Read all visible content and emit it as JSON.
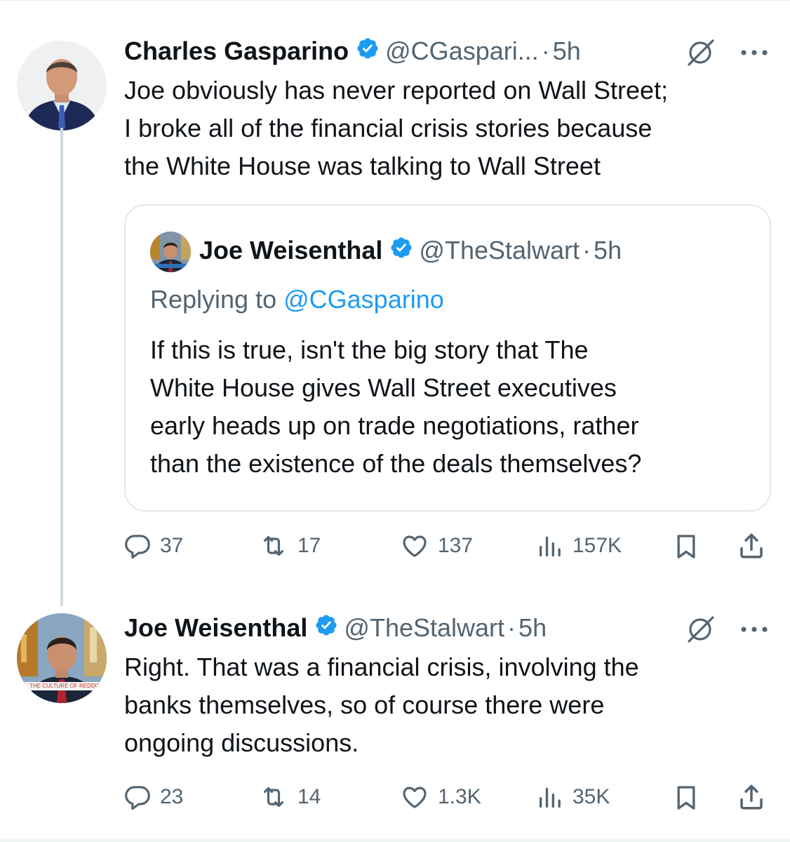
{
  "tweet1": {
    "name": "Charles Gasparino",
    "handle": "@CGaspari...",
    "separator": "·",
    "time": "5h",
    "text": [
      "Joe obviously has never reported on Wall Street;",
      "I broke all of the financial crisis stories because",
      "the White House was talking to Wall Street"
    ],
    "quote": {
      "name": "Joe Weisenthal",
      "handle": "@TheStalwart",
      "separator": "·",
      "time": "5h",
      "replying_prefix": "Replying to",
      "replying_handle": "@CGasparino",
      "text": [
        "If this is true, isn't the big story that The",
        "White House gives Wall Street executives",
        "early heads up on trade negotiations, rather",
        "than the existence of the deals themselves?"
      ]
    },
    "replies": "37",
    "reposts": "17",
    "likes": "137",
    "views": "157K"
  },
  "tweet2": {
    "name": "Joe Weisenthal",
    "handle": "@TheStalwart",
    "separator": "·",
    "time": "5h",
    "avatar_caption": "THE CULTURE OF REDDIT",
    "text": [
      "Right. That was a financial crisis, involving the",
      "banks themselves, so of course there were",
      "ongoing discussions."
    ],
    "replies": "23",
    "reposts": "14",
    "likes": "1.3K",
    "views": "35K"
  },
  "colors": {
    "text": "#0f1419",
    "secondary": "#536471",
    "link": "#1d9bf0",
    "verified": "#1d9bf0",
    "thread_line": "#cfd9de"
  },
  "icons": [
    "verified-badge-icon",
    "grok-icon",
    "more-icon",
    "reply-icon",
    "repost-icon",
    "like-icon",
    "views-icon",
    "bookmark-icon",
    "share-icon"
  ]
}
